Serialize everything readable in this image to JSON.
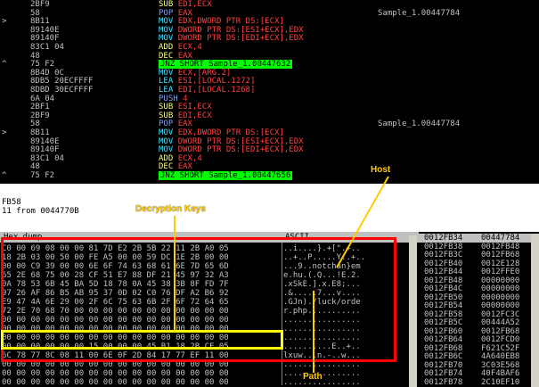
{
  "disasm": [
    {
      "addr": "",
      "code": "2BF9",
      "instr": "SUB EDI,ECX",
      "cmt": ""
    },
    {
      "addr": "",
      "code": "58",
      "instr": "POP EAX",
      "cmt": "Sample_1.00447784"
    },
    {
      "addr": ">",
      "code": "8B11",
      "instr": "MOV EDX,DWORD PTR DS:[ECX]",
      "cmt": ""
    },
    {
      "addr": "",
      "code": "89140E",
      "instr": "MOV DWORD PTR DS:[ESI+ECX],EDX",
      "cmt": ""
    },
    {
      "addr": "",
      "code": "89140F",
      "instr": "MOV DWORD PTR DS:[EDI+ECX],EDX",
      "cmt": ""
    },
    {
      "addr": "",
      "code": "83C1 04",
      "instr": "ADD ECX,4",
      "cmt": ""
    },
    {
      "addr": "",
      "code": "48",
      "instr": "DEC EAX",
      "cmt": ""
    },
    {
      "addr": "^",
      "code": "75 F2",
      "instr": "JNZ SHORT Sample_1.00447632",
      "cmt": "",
      "jump": true
    },
    {
      "addr": "",
      "code": "8B4D 0C",
      "instr": "MOV ECX,[ARG.2]",
      "cmt": ""
    },
    {
      "addr": "",
      "code": "8DB5 20ECFFFF",
      "instr": "LEA ESI,[LOCAL.1272]",
      "cmt": ""
    },
    {
      "addr": "",
      "code": "8DBD 30ECFFFF",
      "instr": "LEA EDI,[LOCAL.1268]",
      "cmt": ""
    },
    {
      "addr": "",
      "code": "6A 04",
      "instr": "PUSH 4",
      "cmt": ""
    },
    {
      "addr": "",
      "code": "2BF1",
      "instr": "SUB ESI,ECX",
      "cmt": ""
    },
    {
      "addr": "",
      "code": "2BF9",
      "instr": "SUB EDI,ECX",
      "cmt": ""
    },
    {
      "addr": "",
      "code": "58",
      "instr": "POP EAX",
      "cmt": "Sample_1.00447784"
    },
    {
      "addr": ">",
      "code": "8B11",
      "instr": "MOV EDX,DWORD PTR DS:[ECX]",
      "cmt": ""
    },
    {
      "addr": "",
      "code": "89140E",
      "instr": "MOV DWORD PTR DS:[ESI+ECX],EDX",
      "cmt": ""
    },
    {
      "addr": "",
      "code": "89140F",
      "instr": "MOV DWORD PTR DS:[EDI+ECX],EDX",
      "cmt": ""
    },
    {
      "addr": "",
      "code": "83C1 04",
      "instr": "ADD ECX,4",
      "cmt": ""
    },
    {
      "addr": "",
      "code": "48",
      "instr": "DEC EAX",
      "cmt": ""
    },
    {
      "addr": "^",
      "code": "75 F2",
      "instr": "JNZ SHORT Sample_1.00447656",
      "cmt": "",
      "jump": true
    }
  ],
  "info": {
    "line1": "FB58",
    "line2": "11 from 0044770B"
  },
  "dump": {
    "header_hex": "Hex dump",
    "header_ascii": "ASCII",
    "rows": [
      {
        "hex": "C0 00 69 08 00 00 81 7D E2 2B 5B 22 11 2B A0 05",
        "ascii": "..i....}.+[\".+.."
      },
      {
        "hex": "18 2B 03 00 50 00 FE A5 00 00 59 DC 1E 2B 00 00",
        "ascii": "..+..P.....Y..+.."
      },
      {
        "hex": "00 00 C9 39 00 00 6E 6F 74 63 68 61 6E 7D 65 6D",
        "ascii": "...9..notchan}em"
      },
      {
        "hex": "65 2E 68 75 00 28 CF 51 E7 88 DF 21 45 97 32 A3",
        "ascii": "e.hu.(.Q...!E.2."
      },
      {
        "hex": "0A 78 53 6B 45 BA 5D 18 78 0A 45 38 3B 8F FD 7F",
        "ascii": ".xSkE.].x.E8;..."
      },
      {
        "hex": "97 26 AF 86 B5 AB 95 37 0D 02 C0 76 DF A2 B6 92",
        "ascii": ".&.....7...v...."
      },
      {
        "hex": "E9 47 4A 6E 29 00 2F 6C 75 63 6B 2F 6F 72 64 65",
        "ascii": ".GJn)./luck/orde"
      },
      {
        "hex": "72 2E 70 68 70 00 00 00 00 00 00 00 00 00 00 00",
        "ascii": "r.php..........."
      },
      {
        "hex": "00 00 00 00 00 00 00 00 00 00 00 00 00 00 00 00",
        "ascii": "................"
      },
      {
        "hex": "00 00 00 00 00 00 00 00 00 00 00 00 00 00 00 00",
        "ascii": "................"
      },
      {
        "hex": "00 00 00 00 00 00 00 00 00 00 00 00 00 00 00 00",
        "ascii": "................"
      },
      {
        "hex": "00 00 00 00 00 00 15 00 00 00 45 B1 18 2B CF 05",
        "ascii": "..........E..+.."
      },
      {
        "hex": "6C 78 77 8C 08 11 00 6E 0F 2D 84 17 77 EF 11 00",
        "ascii": "lxuw...n.-..w..."
      },
      {
        "hex": "00 00 00 00 00 00 00 00 00 00 00 00 00 00 00 00",
        "ascii": "................"
      },
      {
        "hex": "00 00 00 00 00 00 00 00 00 00 00 00 00 00 00 00",
        "ascii": "................"
      },
      {
        "hex": "00 00 00 00 00 00 00 00 00 00 00 00 00 00 00 00",
        "ascii": "................"
      }
    ]
  },
  "stack": [
    {
      "addr": "0012FB34",
      "val": "00447784",
      "sel": true
    },
    {
      "addr": "0012FB38",
      "val": "0012FB48"
    },
    {
      "addr": "0012FB3C",
      "val": "0012FB68"
    },
    {
      "addr": "0012FB40",
      "val": "0012E128"
    },
    {
      "addr": "0012FB44",
      "val": "0012FFE0"
    },
    {
      "addr": "0012FB48",
      "val": "00000000"
    },
    {
      "addr": "0012FB4C",
      "val": "00000000"
    },
    {
      "addr": "0012FB50",
      "val": "00000000"
    },
    {
      "addr": "0012FB54",
      "val": "00000000"
    },
    {
      "addr": "0012FB58",
      "val": "0012FC3C"
    },
    {
      "addr": "0012FB5C",
      "val": "00444A52"
    },
    {
      "addr": "0012FB60",
      "val": "0012FB68"
    },
    {
      "addr": "0012FB64",
      "val": "0012FCD0"
    },
    {
      "addr": "0012FB68",
      "val": "F621C52F"
    },
    {
      "addr": "0012FB6C",
      "val": "4A640EB8"
    },
    {
      "addr": "0012FB70",
      "val": "3C03E568"
    },
    {
      "addr": "0012FB74",
      "val": "40F4BAF6"
    },
    {
      "addr": "0012FB78",
      "val": "2C10EF10"
    }
  ],
  "annotations": {
    "host": "Host",
    "decryption_keys": "Decryption Keys",
    "path": "Path"
  },
  "colors": {
    "annotation": "#ffcc00",
    "highlight_box": "#ff0000",
    "keys_box": "#ffff00",
    "jump_highlight": "#00ff00"
  }
}
